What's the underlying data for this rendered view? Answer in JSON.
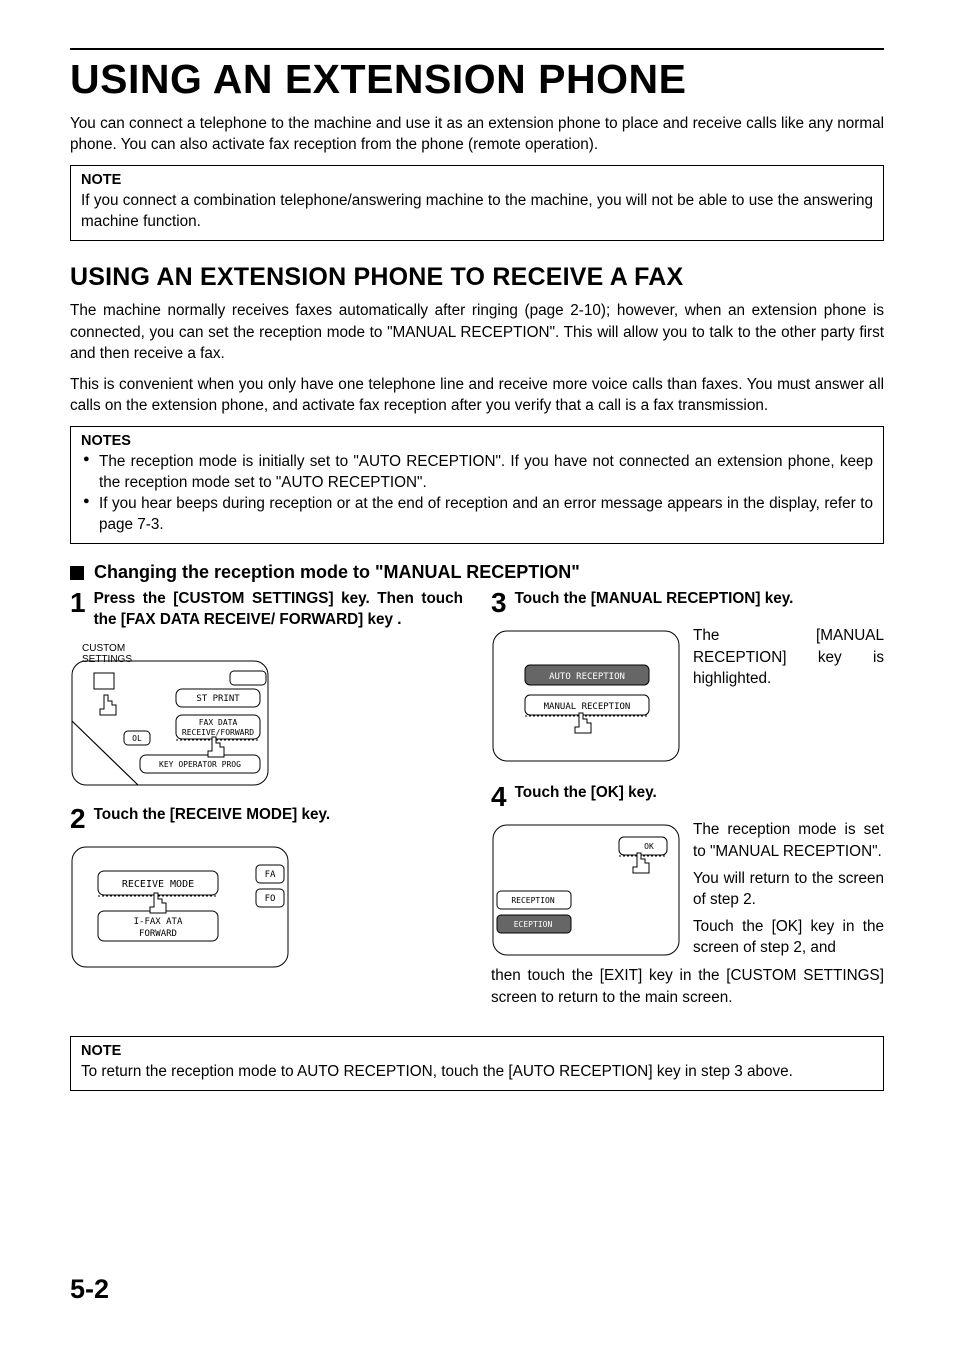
{
  "title": "USING AN EXTENSION PHONE",
  "intro": "You can connect a telephone to the machine and use it as an extension phone to place and receive calls like any normal phone. You can also activate fax reception from the phone (remote operation).",
  "note1": {
    "title": "NOTE",
    "text": "If you connect a combination telephone/answering machine to the machine, you will not be able to use the answering machine function."
  },
  "section2": {
    "title": "USING AN EXTENSION PHONE TO RECEIVE A FAX",
    "p1": "The machine normally receives faxes automatically after ringing (page 2-10); however, when an extension phone is connected, you can set the reception mode to \"MANUAL RECEPTION\". This will allow you to talk to the other party first and then receive a fax.",
    "p2": "This is convenient when you only have one telephone line and receive more voice calls than faxes. You must answer all calls on the extension phone, and activate fax reception after you verify that a call is a fax transmission."
  },
  "notes2": {
    "title": "NOTES",
    "items": [
      "The reception mode is initially set to \"AUTO RECEPTION\". If you have not connected an extension phone, keep the reception mode set to \"AUTO RECEPTION\".",
      "If you hear beeps during reception or at the end of reception and an error message appears in the display, refer to page 7-3."
    ]
  },
  "h3": "Changing the reception mode to \"MANUAL RECEPTION\"",
  "steps": {
    "s1": {
      "num": "1",
      "title": "Press the [CUSTOM SETTINGS] key. Then touch the [FAX DATA RECEIVE/ FORWARD] key .",
      "panel": {
        "labelTop1": "CUSTOM",
        "labelTop2": "SETTINGS",
        "btn1": "ST PRINT",
        "btn2a": "FAX DATA",
        "btn2b": "RECEIVE/FORWARD",
        "btn3": "KEY OPERATOR PROG",
        "btnLeft": "OL"
      }
    },
    "s2": {
      "num": "2",
      "title": "Touch the [RECEIVE MODE] key.",
      "panel": {
        "btn1": "RECEIVE MODE",
        "btn2a": "I-FAX    ATA",
        "btn2b": "FORWARD",
        "right1": "FA",
        "right2": "FO"
      }
    },
    "s3": {
      "num": "3",
      "title": "Touch the [MANUAL RECEPTION] key.",
      "side": "The [MANUAL RECEPTION] key is highlighted.",
      "panel": {
        "btn1": "AUTO RECEPTION",
        "btn2": "MANUAL RECEPTION"
      }
    },
    "s4": {
      "num": "4",
      "title": "Touch the [OK] key.",
      "side1": "The reception mode is set to \"MANUAL RECEPTION\".",
      "side2": "You will return to the screen of step 2.",
      "side3": "Touch the [OK] key in the screen of step 2, and",
      "below": "then touch the [EXIT] key in the [CUSTOM SETTINGS] screen to return to the main screen.",
      "panel": {
        "ok": "OK",
        "row1": "RECEPTION",
        "row2": "ECEPTION"
      }
    }
  },
  "note3": {
    "title": "NOTE",
    "text": "To return the reception mode to AUTO RECEPTION, touch the [AUTO RECEPTION] key in step 3 above."
  },
  "pageNumber": "5-2"
}
